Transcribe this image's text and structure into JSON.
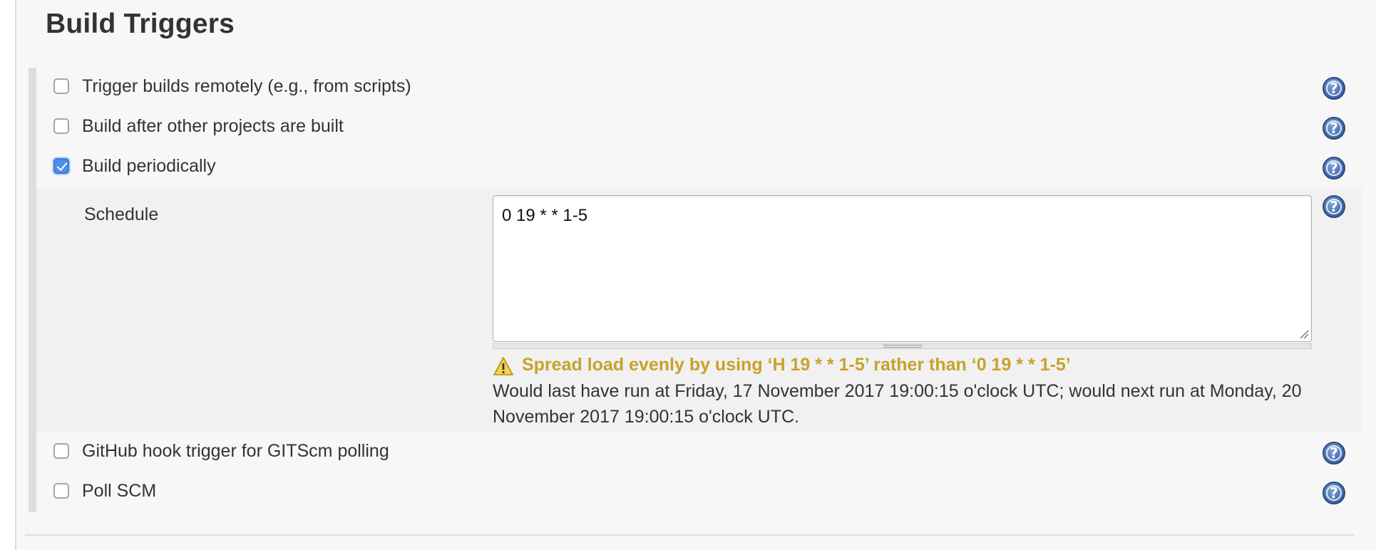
{
  "section": {
    "title": "Build Triggers"
  },
  "triggers": [
    {
      "label": "Trigger builds remotely (e.g., from scripts)",
      "checked": false
    },
    {
      "label": "Build after other projects are built",
      "checked": false
    },
    {
      "label": "Build periodically",
      "checked": true
    },
    {
      "label": "GitHub hook trigger for GITScm polling",
      "checked": false
    },
    {
      "label": "Poll SCM",
      "checked": false
    }
  ],
  "schedule": {
    "label": "Schedule",
    "value": "0 19 * * 1-5",
    "warning": "Spread load evenly by using ‘H 19 * * 1-5’ rather than ‘0 19 * * 1-5’",
    "run_info": "Would last have run at Friday, 17 November 2017 19:00:15 o'clock UTC; would next run at Monday, 20 November 2017 19:00:15 o'clock UTC."
  },
  "icons": {
    "help": "help-icon",
    "warning": "warning-icon",
    "checkmark": "checkmark-icon"
  },
  "colors": {
    "checkbox_checked": "#4d8ee8",
    "warning_text": "#c8a22a",
    "help_icon": "#4a73b4"
  }
}
